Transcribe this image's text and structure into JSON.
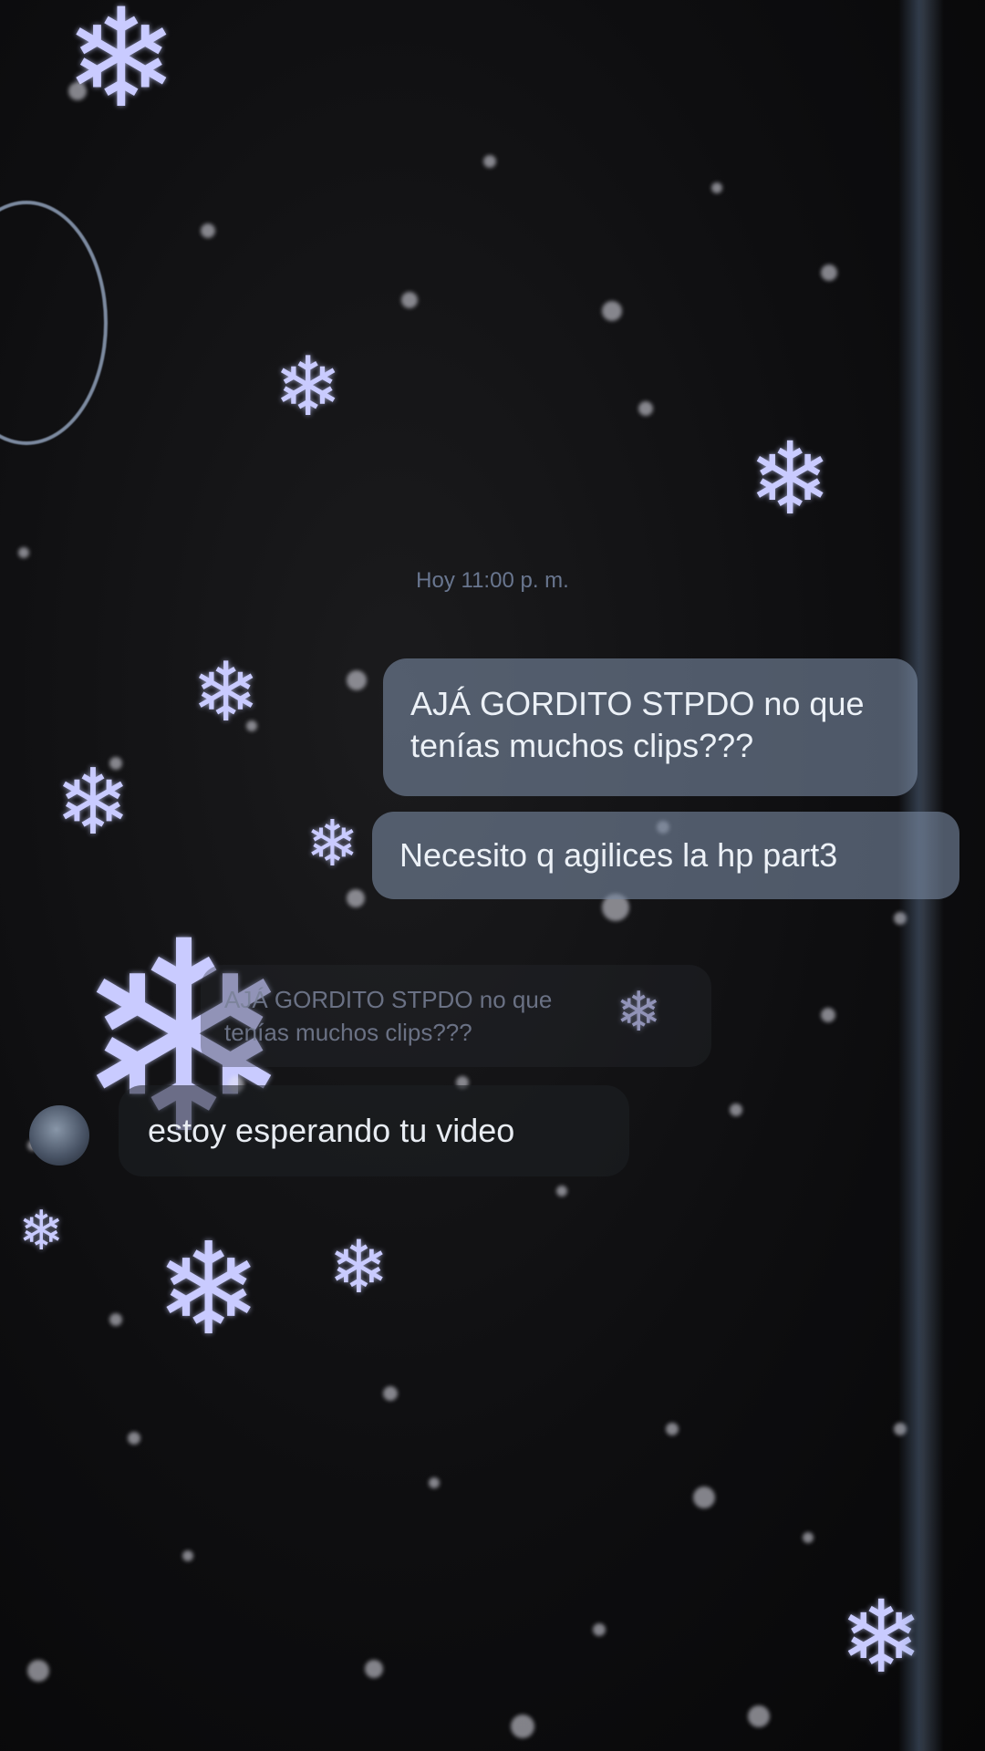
{
  "chat": {
    "timestamp": "Hoy 11:00 p. m.",
    "messages_out": [
      "AJÁ GORDITO STPDO no que tenías muchos clips???",
      "Necesito q agilices la hp part3"
    ],
    "reply": {
      "quoted_text": "AJÁ GORDITO STPDO no que\ntenías muchos clips???"
    },
    "message_in": "estoy esperando tu video"
  },
  "colors": {
    "background": "#0b0b0c",
    "bubble_out": "#7887a0",
    "snowflake": "#c9cbff"
  },
  "icons": {
    "snowflake": "snowflake-icon",
    "avatar": "avatar"
  }
}
